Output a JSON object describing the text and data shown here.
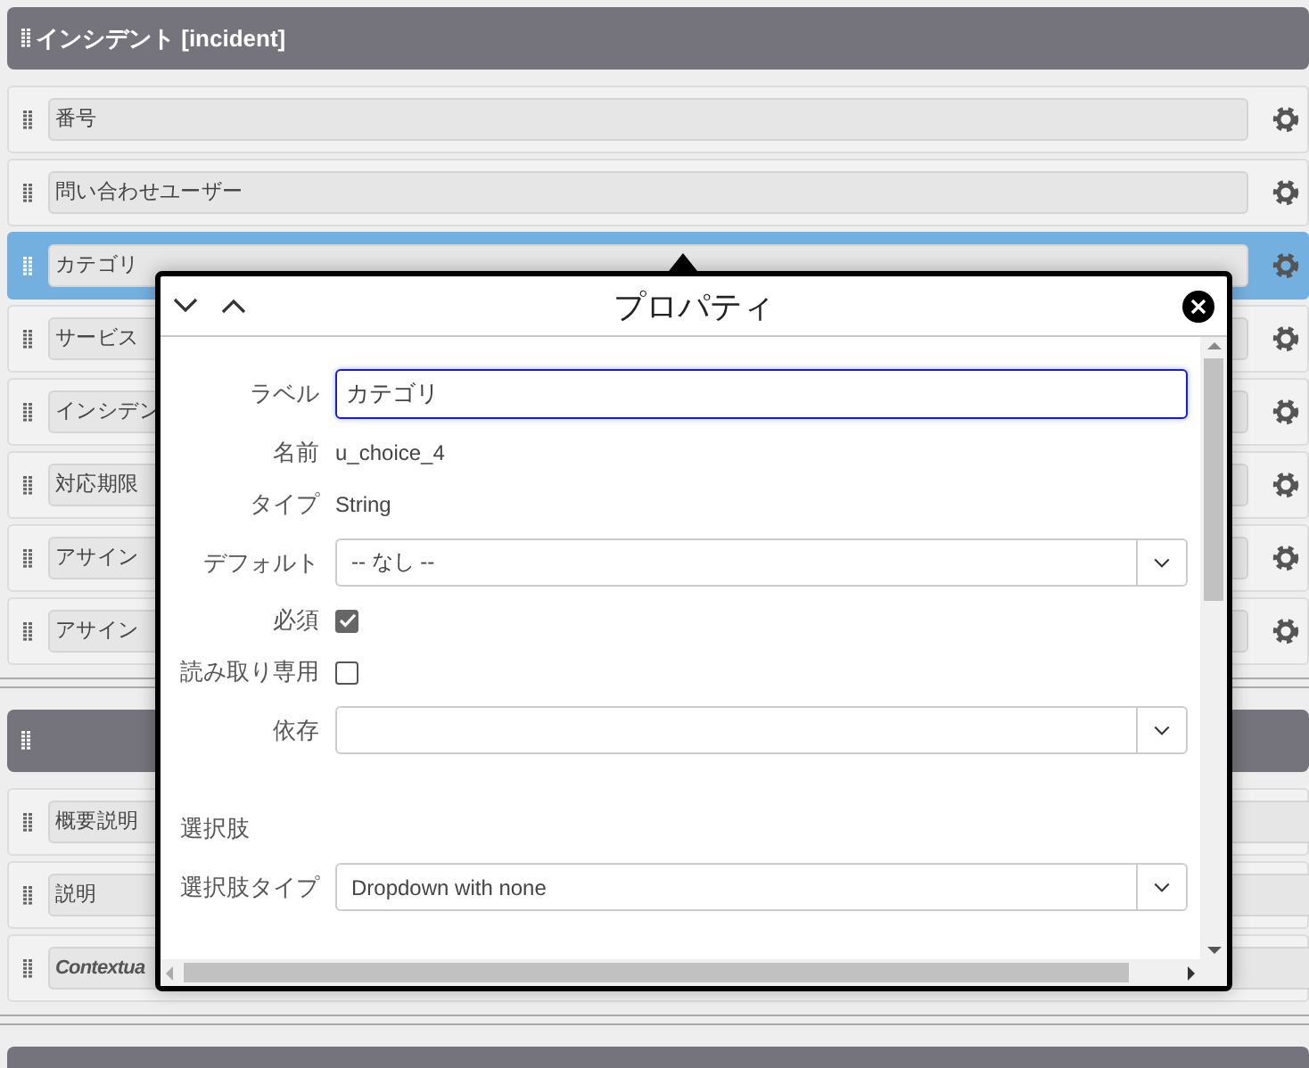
{
  "sections": [
    {
      "kind": "fields",
      "title": "インシデント [incident]",
      "settings_buttons": true,
      "fields": [
        {
          "label": "番号",
          "selected": false,
          "italic": false
        },
        {
          "label": "問い合わせユーザー",
          "selected": false,
          "italic": false
        },
        {
          "label": "カテゴリ",
          "selected": true,
          "italic": false
        },
        {
          "label": "サービス",
          "selected": false,
          "italic": false
        },
        {
          "label": "インシデン",
          "selected": false,
          "italic": false
        },
        {
          "label": "対応期限",
          "selected": false,
          "italic": false
        },
        {
          "label": "アサイン",
          "selected": false,
          "italic": false
        },
        {
          "label": "アサイン",
          "selected": false,
          "italic": false
        }
      ]
    },
    {
      "kind": "fields",
      "settings_buttons": false,
      "fields": [
        {
          "label": "概要説明",
          "selected": false,
          "italic": false
        },
        {
          "label": "説明",
          "selected": false,
          "italic": false
        },
        {
          "label": "Contextua",
          "selected": false,
          "italic": true
        }
      ]
    },
    {
      "kind": "header"
    }
  ],
  "popup": {
    "title": "プロパティ",
    "properties": [
      {
        "kind": "input",
        "label": "ラベル",
        "value": "カテゴリ"
      },
      {
        "kind": "text",
        "label": "名前",
        "value": "u_choice_4"
      },
      {
        "kind": "text",
        "label": "タイプ",
        "value": "String"
      },
      {
        "kind": "select",
        "label": "デフォルト",
        "value": "-- なし --"
      },
      {
        "kind": "checkbox",
        "label": "必須",
        "checked": true
      },
      {
        "kind": "checkbox",
        "label": "読み取り専用",
        "checked": false
      },
      {
        "kind": "select",
        "label": "依存"
      },
      {
        "kind": "heading",
        "label": "選択肢"
      },
      {
        "kind": "select",
        "label": "選択肢タイプ",
        "value": "Dropdown with none"
      }
    ]
  }
}
